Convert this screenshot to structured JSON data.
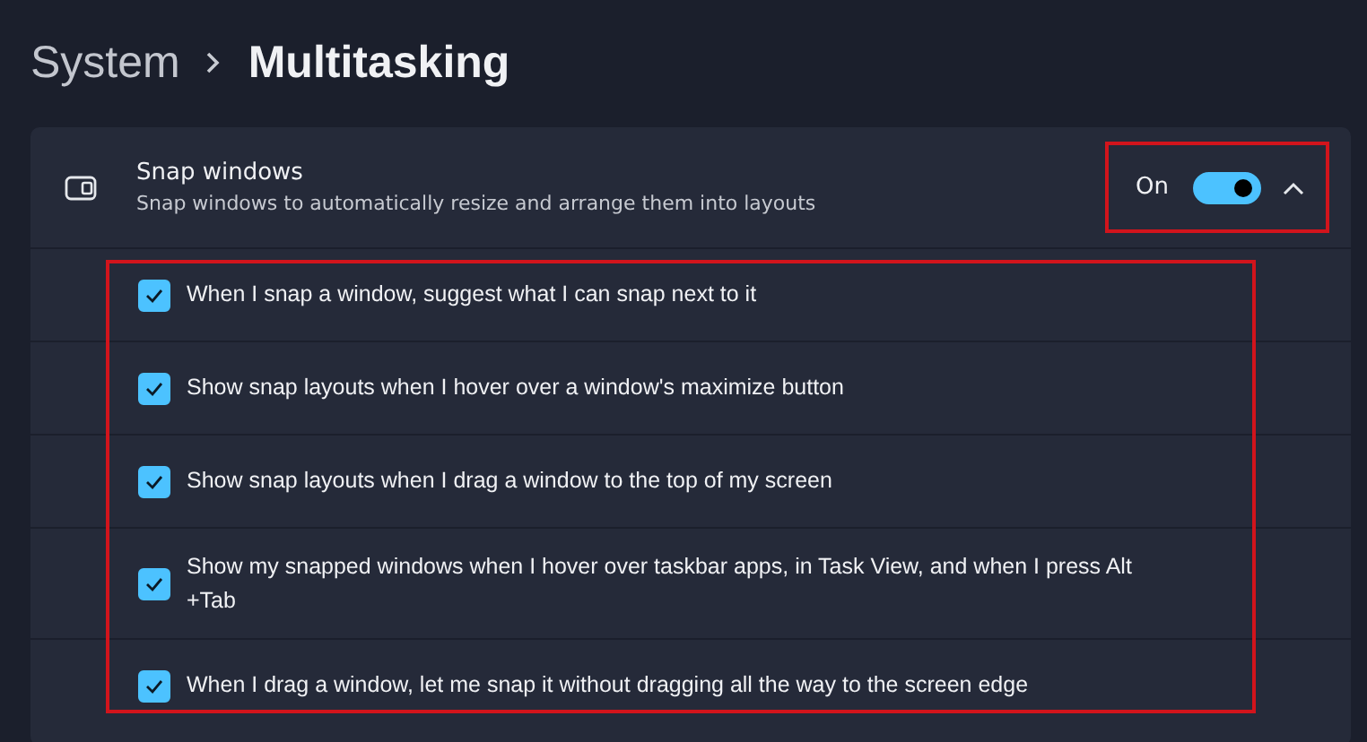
{
  "breadcrumb": {
    "parent": "System",
    "current": "Multitasking"
  },
  "setting": {
    "title": "Snap windows",
    "description": "Snap windows to automatically resize and arrange them into layouts",
    "state_label": "On",
    "on": true,
    "expanded": true
  },
  "options": [
    {
      "label": "When I snap a window, suggest what I can snap next to it",
      "checked": true
    },
    {
      "label": "Show snap layouts when I hover over a window's maximize button",
      "checked": true
    },
    {
      "label": "Show snap layouts when I drag a window to the top of my screen",
      "checked": true
    },
    {
      "label": "Show my snapped windows when I hover over taskbar apps, in Task View, and when I press Alt +Tab",
      "checked": true
    },
    {
      "label": "When I drag a window, let me snap it without dragging all the way to the screen edge",
      "checked": true
    }
  ]
}
